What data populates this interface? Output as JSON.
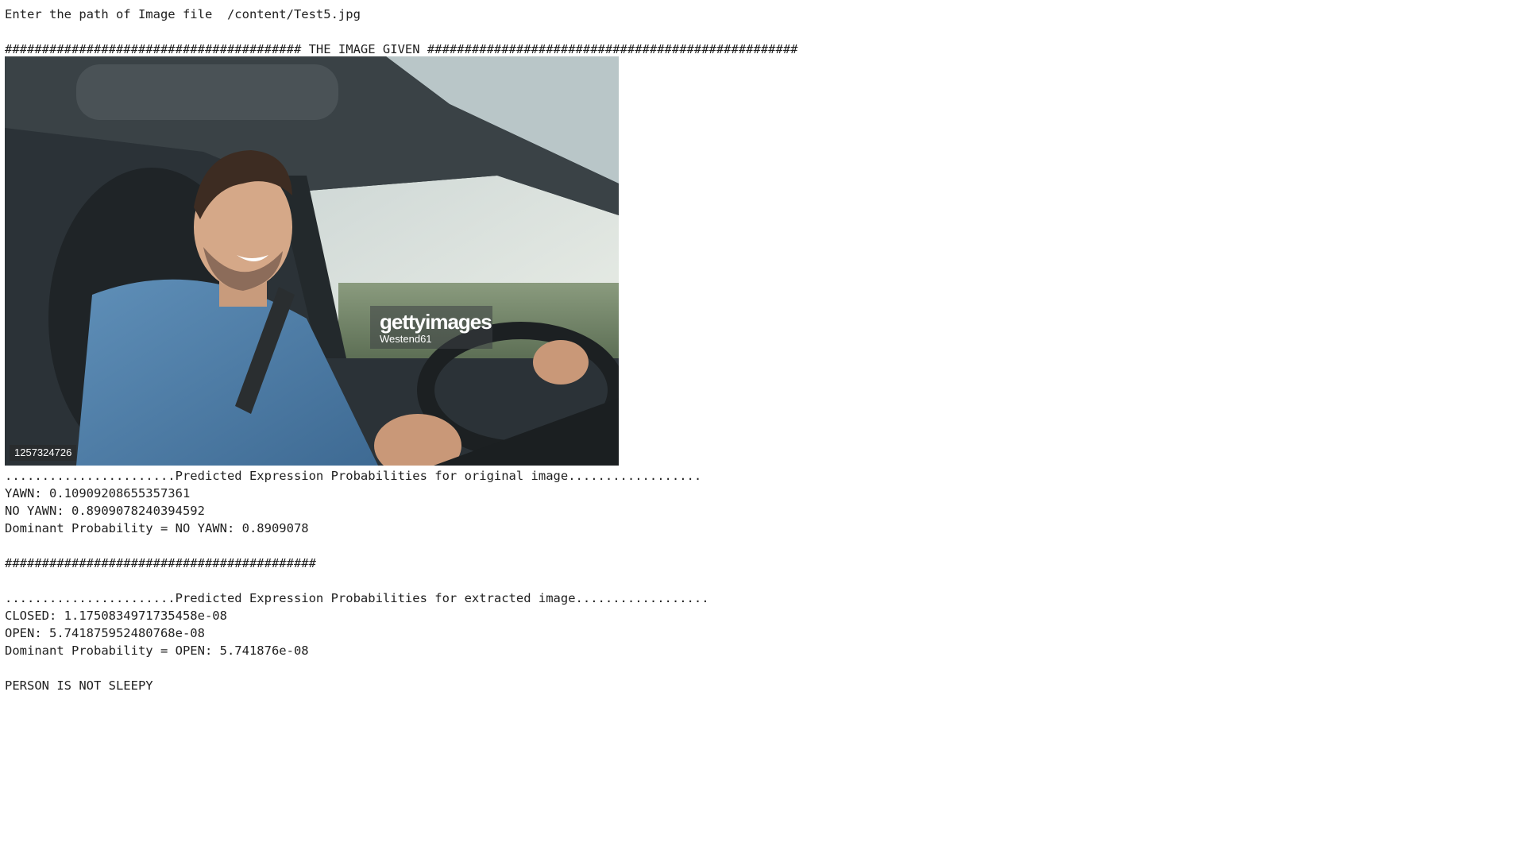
{
  "output": {
    "prompt_line": "Enter the path of Image file  /content/Test5.jpg",
    "image_header": "######################################## THE IMAGE GIVEN ##################################################",
    "image": {
      "description_icon": "photo-driver-smiling-in-car",
      "watermark_brand": "gettyimages",
      "watermark_credit": "Westend61",
      "image_id": "1257324726"
    },
    "original_header": ".......................Predicted Expression Probabilities for original image..................",
    "yawn_line": "YAWN: 0.10909208655357361",
    "no_yawn_line": "NO YAWN: 0.8909078240394592",
    "dominant_original": "Dominant Probability = NO YAWN: 0.8909078",
    "separator": "##########################################",
    "extracted_header": ".......................Predicted Expression Probabilities for extracted image..................",
    "closed_line": "CLOSED: 1.1750834971735458e-08",
    "open_line": "OPEN: 5.741875952480768e-08",
    "dominant_extracted": "Dominant Probability = OPEN: 5.741876e-08",
    "verdict": "PERSON IS NOT SLEEPY"
  }
}
